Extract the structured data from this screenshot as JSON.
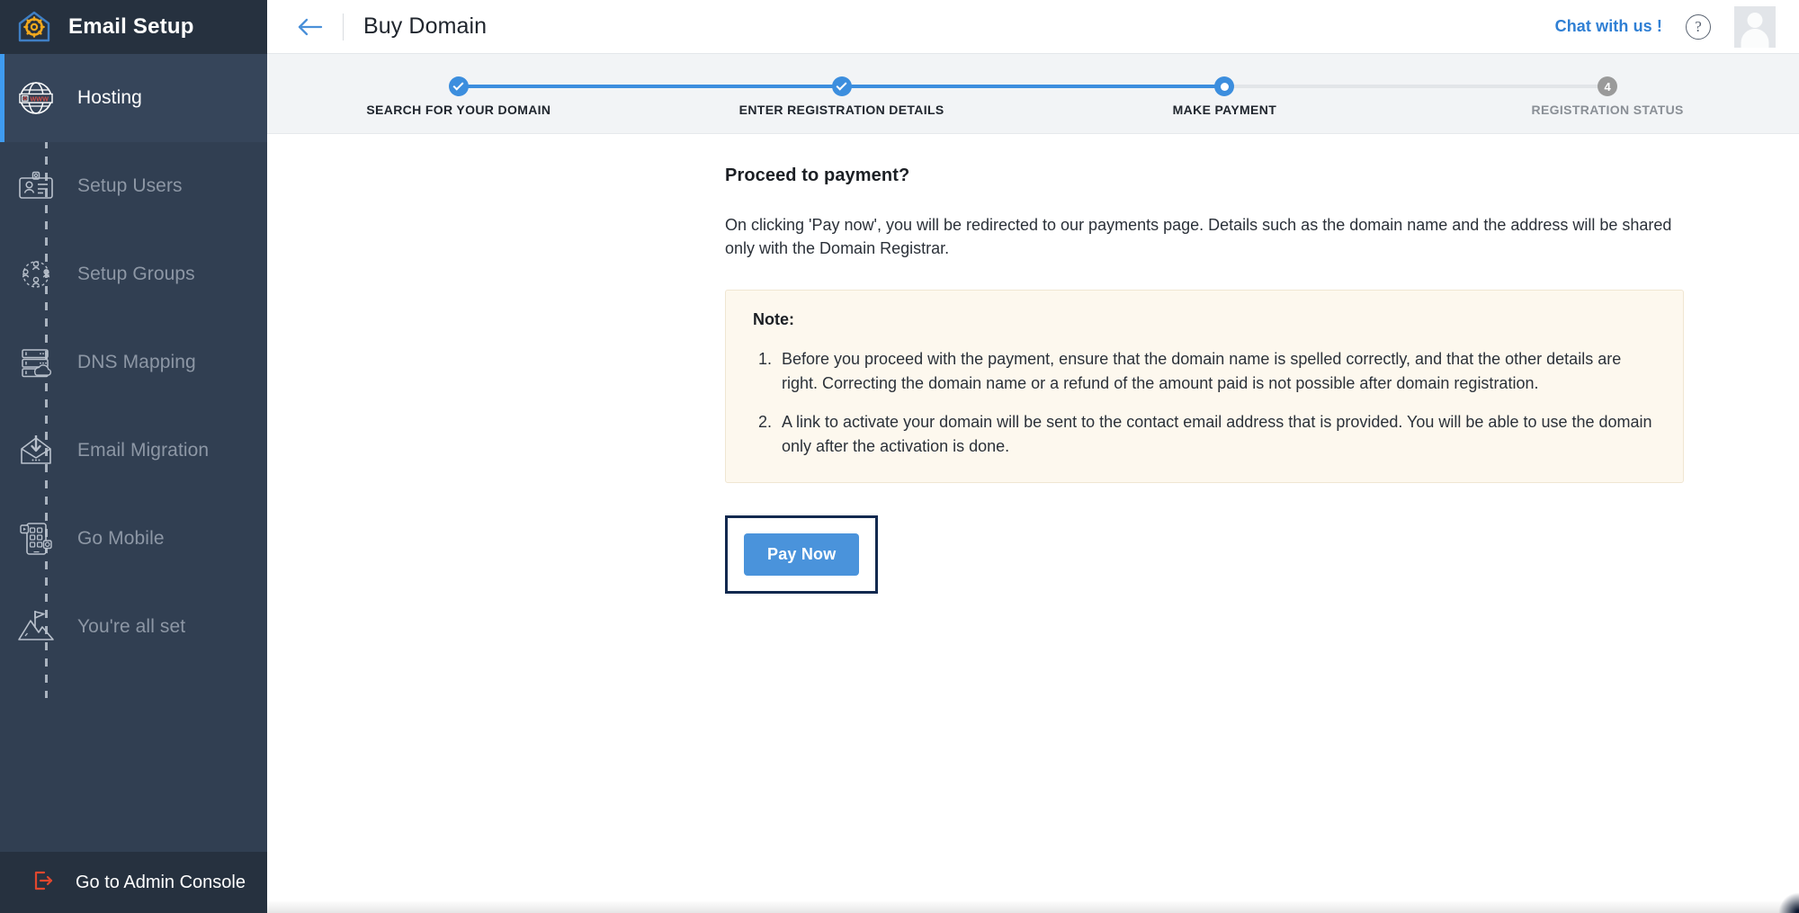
{
  "sidebar": {
    "brand": "Email Setup",
    "brand_icon": "house-gear-icon",
    "items": [
      {
        "label": "Hosting",
        "icon": "globe-www-icon",
        "active": true
      },
      {
        "label": "Setup Users",
        "icon": "id-card-user-icon",
        "active": false
      },
      {
        "label": "Setup Groups",
        "icon": "user-group-icon",
        "active": false
      },
      {
        "label": "DNS Mapping",
        "icon": "server-cloud-icon",
        "active": false
      },
      {
        "label": "Email Migration",
        "icon": "envelope-download-icon",
        "active": false
      },
      {
        "label": "Go Mobile",
        "icon": "mobile-apps-icon",
        "active": false
      },
      {
        "label": "You're all set",
        "icon": "mountain-flag-icon",
        "active": false
      }
    ],
    "footer": {
      "label": "Go to Admin Console",
      "icon": "logout-icon",
      "icon_color": "#e0472e"
    }
  },
  "topbar": {
    "back_icon": "arrow-left-icon",
    "title": "Buy Domain",
    "chat_label": "Chat with us !",
    "help_icon": "question-mark-icon",
    "help_glyph": "?",
    "avatar": "user-avatar",
    "accent_color": "#2f7fd4"
  },
  "stepper": {
    "steps": [
      {
        "label": "SEARCH FOR YOUR DOMAIN",
        "state": "done",
        "marker": "check"
      },
      {
        "label": "ENTER REGISTRATION DETAILS",
        "state": "done",
        "marker": "check"
      },
      {
        "label": "MAKE PAYMENT",
        "state": "current",
        "marker": "dot"
      },
      {
        "label": "REGISTRATION STATUS",
        "state": "pending",
        "marker": "4"
      }
    ],
    "active_color": "#3c8ede",
    "pending_color": "#9a9a9a"
  },
  "content": {
    "heading": "Proceed to payment?",
    "lead": "On clicking 'Pay now', you will be redirected to our payments page. Details such as the domain name and the address will be shared only with the Domain Registrar.",
    "note": {
      "title": "Note:",
      "items": [
        "Before you proceed with the payment, ensure that the domain name is spelled correctly, and that the other details are right. Correcting the domain name or a refund of the amount paid is not possible after domain registration.",
        "A link to activate your domain will be sent to the contact email address that is provided. You will be able to use the domain only after the activation is done."
      ]
    },
    "pay_button": "Pay Now",
    "pay_button_color": "#4a93db",
    "highlight_color": "#12294f"
  }
}
